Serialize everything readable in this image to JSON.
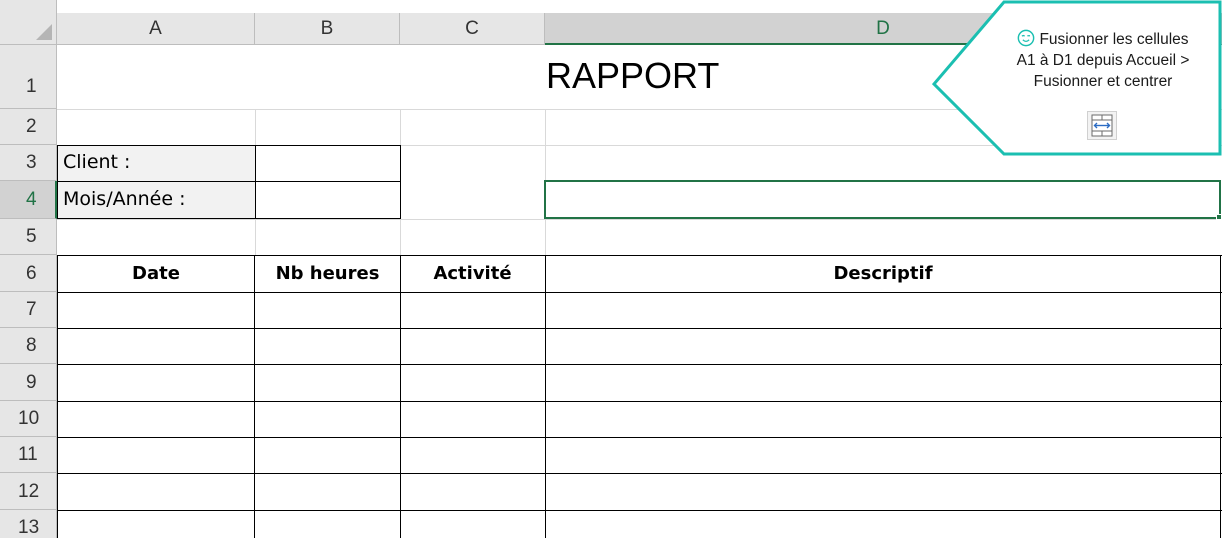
{
  "spreadsheet": {
    "columns": [
      "A",
      "B",
      "C",
      "D"
    ],
    "selected_column": "D",
    "rows": [
      "1",
      "2",
      "3",
      "4",
      "5",
      "6",
      "7",
      "8",
      "9",
      "10",
      "11",
      "12",
      "13"
    ],
    "selected_row": "4",
    "title": "RAPPORT",
    "client_label": "Client :",
    "month_year_label": "Mois/Année :",
    "table_headers": [
      "Date",
      "Nb heures",
      "Activité",
      "Descriptif"
    ]
  },
  "tooltip": {
    "text_line1": "Fusionner les cellules",
    "text_line2": "A1 à D1 depuis Accueil >",
    "text_line3": "Fusionner et centrer",
    "emoji_icon": "wink-face-icon",
    "action_icon": "merge-center-icon",
    "accent_color": "#1bbfb1"
  },
  "colors": {
    "selection": "#217346",
    "header_bg": "#e6e6e6",
    "gridline": "#d9d9d9"
  }
}
